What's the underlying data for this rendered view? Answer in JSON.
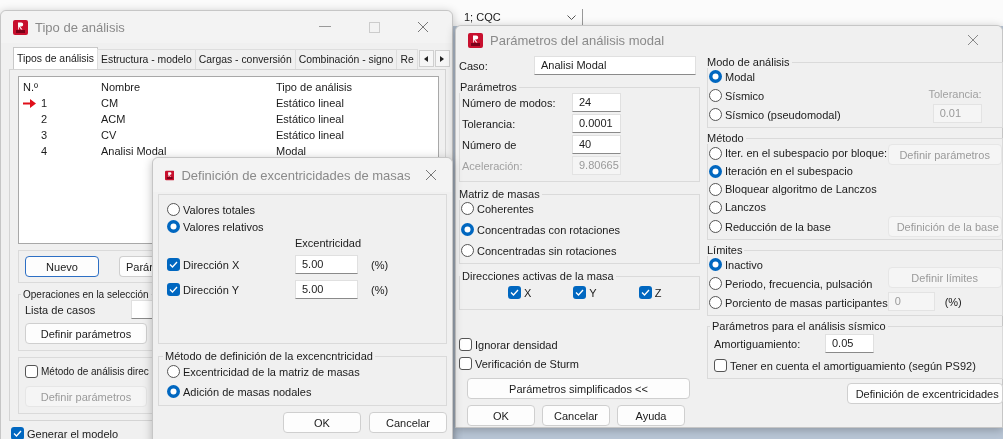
{
  "combo_box": {
    "value": "1; CQC"
  },
  "analysis_types_window": {
    "title": "Tipo de análisis",
    "tabs": [
      {
        "label": "Tipos de análisis",
        "selected": true
      },
      {
        "label": "Estructura - modelo",
        "selected": false
      },
      {
        "label": "Cargas - conversión",
        "selected": false
      },
      {
        "label": "Combinación - signo",
        "selected": false
      },
      {
        "label": "Re",
        "selected": false
      }
    ],
    "table": {
      "columns": [
        "N.º",
        "Nombre",
        "Tipo de análisis"
      ],
      "rows": [
        {
          "number": "1",
          "name": "CM",
          "analysis": "Estático lineal",
          "current": true
        },
        {
          "number": "2",
          "name": "ACM",
          "analysis": "Estático lineal",
          "current": false
        },
        {
          "number": "3",
          "name": "CV",
          "analysis": "Estático lineal",
          "current": false
        },
        {
          "number": "4",
          "name": "Analisi Modal",
          "analysis": "Modal",
          "current": false
        }
      ]
    },
    "buttons": [
      {
        "label": "Nuevo",
        "default": true
      },
      {
        "label": "Parár",
        "default": false
      }
    ],
    "selection_group": {
      "title": "Operaciones en la selección",
      "case_list_label": "Lista de casos",
      "button": "Definir parámetros"
    },
    "direct_method": {
      "label": "Método de análisis direc",
      "checked": false,
      "button": {
        "label": "Definir parámetros",
        "disabled": true
      }
    },
    "generate_model": {
      "label": "Generar el modelo",
      "checked": true
    }
  },
  "eccentricity_dialog": {
    "title": "Definición de excentricidades de masas",
    "value_mode": [
      {
        "label": "Valores totales",
        "selected": false
      },
      {
        "label": "Valores relativos",
        "selected": true
      }
    ],
    "column_header": "Excentricidad",
    "directions": [
      {
        "label": "Dirección X",
        "checked": true,
        "value": "5.00",
        "unit": "(%)"
      },
      {
        "label": "Dirección Y",
        "checked": true,
        "value": "5.00",
        "unit": "(%)"
      }
    ],
    "method_group": {
      "title": "Método de definición de la excencntricidad",
      "options": [
        {
          "label": "Excentricidad de la matriz de masas",
          "selected": false
        },
        {
          "label": "Adición de masas nodales",
          "selected": true
        }
      ]
    },
    "buttons": [
      "OK",
      "Cancelar"
    ]
  },
  "modal_window": {
    "title": "Parámetros del análisis modal",
    "case": {
      "label": "Caso:",
      "value": "Analisi Modal"
    },
    "parameters": {
      "title": "Parámetros",
      "rows": [
        {
          "label": "Número de modos:",
          "value": "24",
          "disabled": false
        },
        {
          "label": "Tolerancia:",
          "value": "0.0001",
          "disabled": false
        },
        {
          "label": "Número de",
          "value": "40",
          "disabled": false
        },
        {
          "label": "Aceleración:",
          "value": "9.80665",
          "disabled": true
        }
      ]
    },
    "mass_matrix": {
      "title": "Matriz de masas",
      "options": [
        {
          "label": "Coherentes",
          "selected": false
        },
        {
          "label": "Concentradas con rotaciones",
          "selected": true
        },
        {
          "label": "Concentradas sin rotaciones",
          "selected": false
        }
      ]
    },
    "mass_directions": {
      "title": "Direcciones activas de la masa",
      "options": [
        {
          "label": "X",
          "checked": true
        },
        {
          "label": "Y",
          "checked": true
        },
        {
          "label": "Z",
          "checked": true
        }
      ]
    },
    "options": [
      {
        "label": "Ignorar densidad",
        "checked": false
      },
      {
        "label": "Verificación de Sturm",
        "checked": false
      }
    ],
    "simplified_button": "Parámetros simplificados <<",
    "buttons": [
      "OK",
      "Cancelar",
      "Ayuda"
    ],
    "analysis_mode": {
      "title": "Modo de análisis",
      "options": [
        {
          "label": "Modal",
          "selected": true
        },
        {
          "label": "Sísmico",
          "selected": false
        },
        {
          "label": "Sísmico (pseudomodal)",
          "selected": false
        }
      ],
      "tolerance": {
        "label": "Tolerancia:",
        "value": "0.01",
        "disabled": true
      }
    },
    "method": {
      "title": "Método",
      "options": [
        {
          "label": "Iter. en el subespacio por bloque:",
          "selected": false
        },
        {
          "label": "Iteración en el subespacio",
          "selected": true
        },
        {
          "label": "Bloquear algoritmo de Lanczos",
          "selected": false
        },
        {
          "label": "Lanczos",
          "selected": false
        },
        {
          "label": "Reducción de la base",
          "selected": false
        }
      ],
      "buttons": [
        {
          "label": "Definir parámetros",
          "disabled": true
        },
        {
          "label": "Definición de la base",
          "disabled": true
        }
      ]
    },
    "limits": {
      "title": "Límites",
      "options": [
        {
          "label": "Inactivo",
          "selected": true
        },
        {
          "label": "Periodo, frecuencia, pulsación",
          "selected": false
        },
        {
          "label": "Porciento de masas participantes",
          "selected": false
        }
      ],
      "button": {
        "label": "Definir límites",
        "disabled": true
      },
      "field": {
        "value": "0",
        "disabled": true
      },
      "unit": "(%)"
    },
    "seismic": {
      "title": "Parámetros para el análisis sísmico",
      "damping": {
        "label": "Amortiguamiento:",
        "value": "0.05"
      },
      "option": {
        "label": "Tener en cuenta el amortiguamiento (según PS92)",
        "checked": false
      }
    },
    "eccentricity_button": "Definición de excentricidades"
  }
}
